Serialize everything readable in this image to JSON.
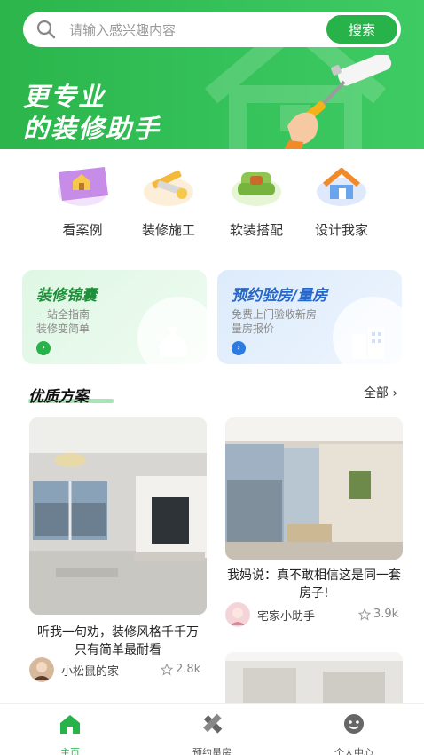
{
  "search": {
    "placeholder": "请输入感兴趣内容",
    "button_label": "搜索"
  },
  "banner": {
    "line1": "更专业",
    "line2": "的装修助手"
  },
  "categories": [
    {
      "label": "看案例",
      "icon": "blueprint-house-icon"
    },
    {
      "label": "装修施工",
      "icon": "tools-icon"
    },
    {
      "label": "软装搭配",
      "icon": "sofa-icon"
    },
    {
      "label": "设计我家",
      "icon": "house-icon"
    }
  ],
  "promos": [
    {
      "title": "装修锦囊",
      "sub1": "一站全指南",
      "sub2": "装修变简单",
      "icon": "money-bag-icon"
    },
    {
      "title": "预约验房/量房",
      "sub1": "免费上门验收新房",
      "sub2": "量房报价",
      "icon": "building-icon"
    }
  ],
  "section": {
    "title": "优质方案",
    "all_label": "全部"
  },
  "feed": [
    {
      "title": "听我一句劝，装修风格千千万 只有简单最耐看",
      "author": "小松鼠的家",
      "likes": "2.8k"
    },
    {
      "title": "我妈说：真不敢相信这是同一套房子!",
      "author": "宅家小助手",
      "likes": "3.9k"
    }
  ],
  "nav": [
    {
      "label": "主页",
      "icon": "home-icon",
      "active": true
    },
    {
      "label": "预约量房",
      "icon": "ruler-pencil-icon",
      "active": false
    },
    {
      "label": "个人中心",
      "icon": "profile-icon",
      "active": false
    }
  ],
  "colors": {
    "primary": "#27b24a",
    "blue_accent": "#2566c8"
  }
}
